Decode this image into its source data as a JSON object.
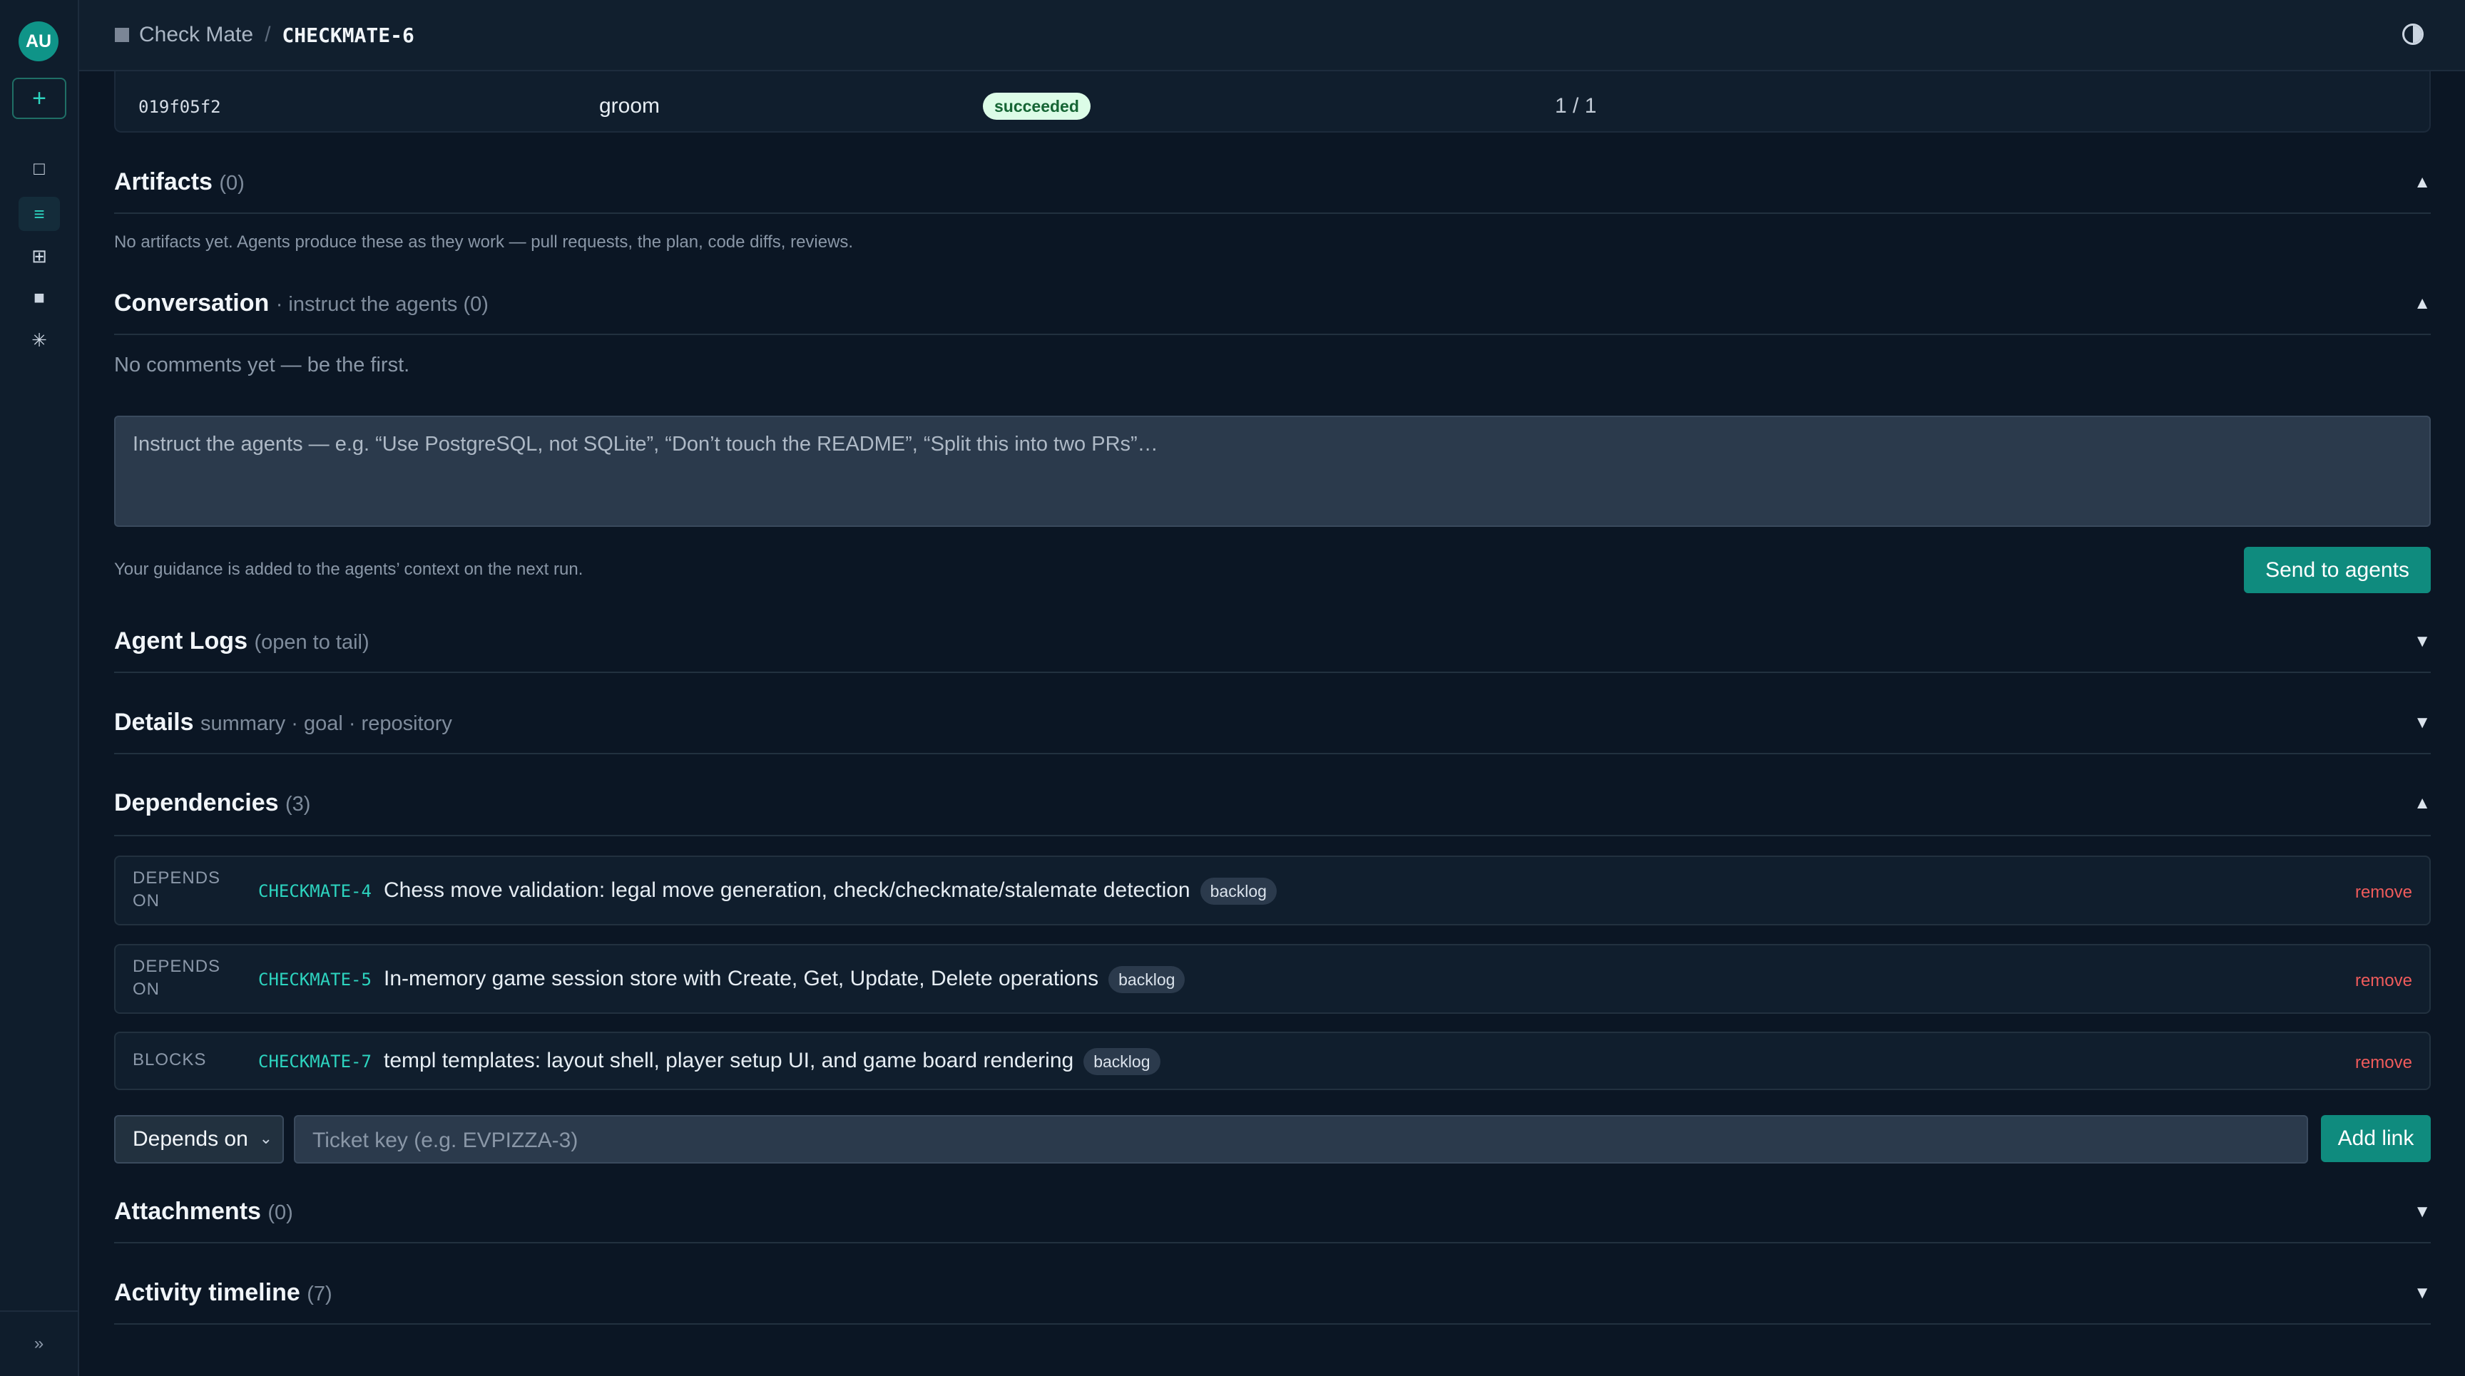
{
  "sidebar": {
    "avatar": "AU",
    "new_button": "+",
    "nav": [
      {
        "icon": "square-outline-icon",
        "glyph": "□"
      },
      {
        "icon": "list-icon",
        "glyph": "≡"
      },
      {
        "icon": "grid-icon",
        "glyph": "⊞"
      },
      {
        "icon": "square-filled-icon",
        "glyph": "■"
      },
      {
        "icon": "asterisk-icon",
        "glyph": "✳"
      }
    ],
    "collapse": "»"
  },
  "header": {
    "project": "Check Mate",
    "separator": "/",
    "ticket": "CHECKMATE-6"
  },
  "run": {
    "id": "019f05f2",
    "stage": "groom",
    "status": "succeeded",
    "count": "1 / 1"
  },
  "artifacts": {
    "title": "Artifacts",
    "count": "(0)",
    "empty": "No artifacts yet. Agents produce these as they work — pull requests, the plan, code diffs, reviews."
  },
  "conversation": {
    "title": "Conversation",
    "meta": "· instruct the agents (0)",
    "empty": "No comments yet — be the first.",
    "placeholder": "Instruct the agents — e.g. “Use PostgreSQL, not SQLite”, “Don’t touch the README”, “Split this into two PRs”…",
    "hint": "Your guidance is added to the agents’ context on the next run.",
    "send": "Send to agents"
  },
  "agent_logs": {
    "title": "Agent Logs",
    "meta": "(open to tail)"
  },
  "details": {
    "title": "Details",
    "meta": "summary · goal · repository"
  },
  "dependencies": {
    "title": "Dependencies",
    "count": "(3)",
    "items": [
      {
        "kind": "DEPENDS ON",
        "key": "CHECKMATE-4",
        "title": "Chess move validation: legal move generation, check/checkmate/stalemate detection",
        "status": "backlog",
        "action": "remove"
      },
      {
        "kind": "DEPENDS ON",
        "key": "CHECKMATE-5",
        "title": "In-memory game session store with Create, Get, Update, Delete operations",
        "status": "backlog",
        "action": "remove"
      },
      {
        "kind": "BLOCKS",
        "key": "CHECKMATE-7",
        "title": "templ templates: layout shell, player setup UI, and game board rendering",
        "status": "backlog",
        "action": "remove"
      }
    ],
    "relation_select": "Depends on",
    "key_placeholder": "Ticket key (e.g. EVPIZZA-3)",
    "add_button": "Add link"
  },
  "attachments": {
    "title": "Attachments",
    "count": "(0)"
  },
  "activity": {
    "title": "Activity timeline",
    "count": "(7)"
  },
  "carets": {
    "up": "▲",
    "down": "▼"
  },
  "colors": {
    "accent": "#0f8b7e",
    "accent_text": "#2dd4bf",
    "danger": "#ef5b5b",
    "background": "#0b1624"
  }
}
